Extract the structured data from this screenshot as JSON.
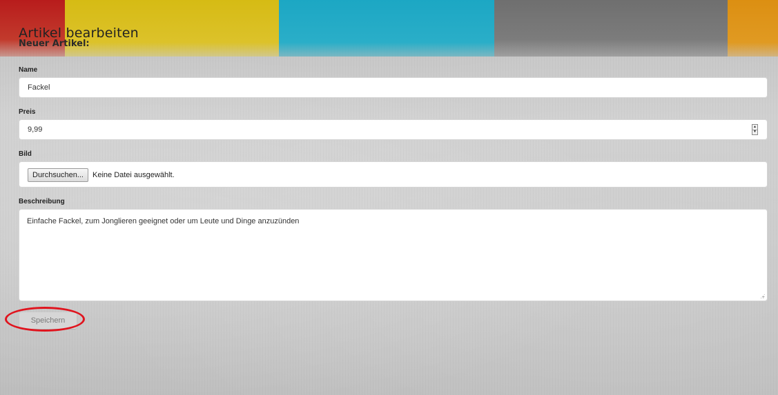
{
  "page": {
    "title": "Artikel bearbeiten",
    "subtitle": "Neuer Artikel:"
  },
  "form": {
    "name": {
      "label": "Name",
      "value": "Fackel"
    },
    "price": {
      "label": "Preis",
      "value": "9,99"
    },
    "image": {
      "label": "Bild",
      "button_label": "Durchsuchen...",
      "status": "Keine Datei ausgewählt."
    },
    "description": {
      "label": "Beschreibung",
      "value": "Einfache Fackel, zum Jonglieren geeignet oder um Leute und Dinge anzuzünden"
    },
    "save_label": "Speichern"
  },
  "colors": {
    "highlight": "#e0141e",
    "band_red": "#b81c1c",
    "band_yellow": "#d6bb14",
    "band_cyan": "#1ca7c4",
    "band_grey": "#6f6f6f",
    "band_orange": "#dc8f12"
  },
  "icons": {
    "spinner_up": "spinner-up-icon",
    "spinner_down": "spinner-down-icon",
    "resize": "resize-handle-icon"
  }
}
